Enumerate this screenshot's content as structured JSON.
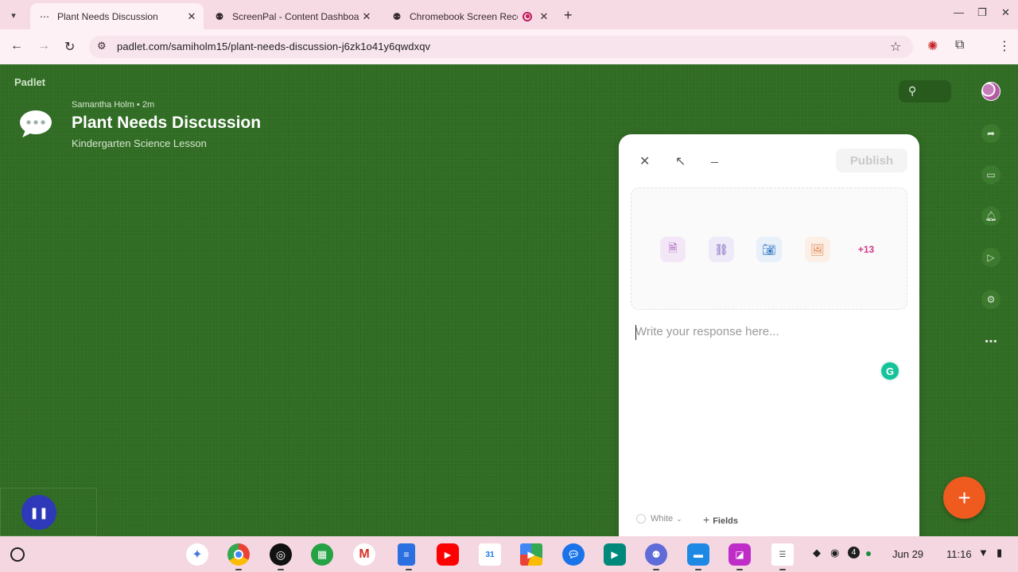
{
  "browser": {
    "tabs": [
      {
        "title": "Plant Needs Discussion",
        "active": true,
        "favicon": "padlet-icon"
      },
      {
        "title": "ScreenPal - Content Dashboard",
        "active": false,
        "favicon": "screenpal-icon"
      },
      {
        "title": "Chromebook Screen Recor",
        "active": false,
        "favicon": "screenpal-icon",
        "recording": true
      }
    ],
    "url": "padlet.com/samiholm15/plant-needs-discussion-j6zk1o41y6qwdxqv"
  },
  "board": {
    "brand": "Padlet",
    "author": "Samantha Holm • 2m",
    "title": "Plant Needs Discussion",
    "subtitle": "Kindergarten Science Lesson"
  },
  "composer": {
    "publish_label": "Publish",
    "attachments": [
      "file-upload-icon",
      "link-icon",
      "camera-icon",
      "image-search-icon"
    ],
    "more_label": "+13",
    "placeholder": "Write your response here...",
    "color_label": "White",
    "fields_label": "Fields"
  },
  "shelf": {
    "date": "Jun 29",
    "time": "11:16",
    "notification_count": "4"
  },
  "colors": {
    "board_bg": "#2f6b22",
    "fab": "#ef5a1f",
    "accent_pink": "#d0398a"
  }
}
